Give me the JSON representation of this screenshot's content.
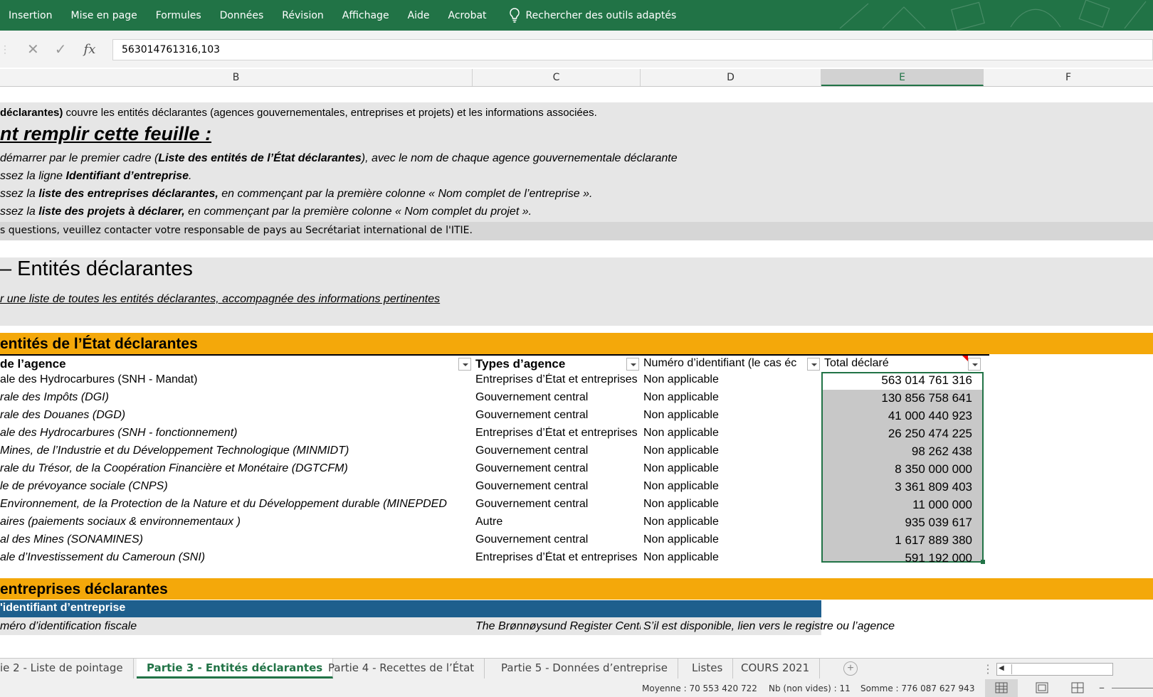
{
  "ribbon": {
    "tabs": [
      "Insertion",
      "Mise en page",
      "Formules",
      "Données",
      "Révision",
      "Affichage",
      "Aide",
      "Acrobat"
    ],
    "search_label": "Rechercher des outils adaptés"
  },
  "formula_bar": {
    "cancel_icon": "✕",
    "enter_icon": "✓",
    "fx_label": "fx",
    "value": "563014761316,103"
  },
  "columns": [
    "B",
    "C",
    "D",
    "E",
    "F"
  ],
  "selected_column": "E",
  "sheet": {
    "intro": {
      "line1_bold": "déclarantes)",
      "line1_rest": " couvre les entités déclarantes (agences gouvernementales, entreprises et projets) et les informations associées.",
      "how_to_title": "nt remplir cette feuille :",
      "step1_pre": "démarrer par le premier cadre (",
      "step1_bold": "Liste des entités de l’État déclarantes",
      "step1_post": "), avec le nom de chaque agence gouvernementale déclarante",
      "step2_pre": "ssez la ligne ",
      "step2_bold": "Identifiant d’entreprise",
      "step2_post": ".",
      "step3_pre": "ssez la ",
      "step3_bold": "liste des entreprises déclarantes,",
      "step3_post": " en commençant par la première colonne « Nom complet de l’entreprise ».",
      "step4_pre": "ssez la ",
      "step4_bold": "liste des projets à déclarer,",
      "step4_post": " en commençant par la première colonne « Nom complet du projet ».",
      "contact": "s questions, veuillez contacter votre responsable de pays au Secrétariat international de l'ITIE."
    },
    "section_title": "– Entités déclarantes",
    "section_subtitle": "r une liste de toutes les entités déclarantes, accompagnée des informations pertinentes",
    "state_table": {
      "title": "entités de l’État déclarantes",
      "headers": [
        "de l’agence",
        "Types d’agence",
        "Numéro d’identifiant (le cas éc",
        "Total déclaré"
      ],
      "rows": [
        {
          "name": "ale des Hydrocarbures (SNH - Mandat)",
          "type": "Entreprises d’État et entreprises",
          "id": "Non applicable",
          "total": "563 014 761 316",
          "italic": false
        },
        {
          "name": "rale des Impôts (DGI)",
          "type": "Gouvernement central",
          "id": "Non applicable",
          "total": "130 856 758 641",
          "italic": true
        },
        {
          "name": "rale des Douanes (DGD)",
          "type": "Gouvernement central",
          "id": "Non applicable",
          "total": "41 000 440 923",
          "italic": true
        },
        {
          "name": "ale des Hydrocarbures (SNH - fonctionnement)",
          "type": "Entreprises d’État et entreprises",
          "id": "Non applicable",
          "total": "26 250 474 225",
          "italic": true
        },
        {
          "name": "Mines, de l’Industrie et du Développement Technologique (MINMIDT)",
          "type": "Gouvernement central",
          "id": "Non applicable",
          "total": "98 262 438",
          "italic": true
        },
        {
          "name": "rale du Trésor, de la Coopération Financière et Monétaire (DGTCFM)",
          "type": "Gouvernement central",
          "id": "Non applicable",
          "total": "8 350 000 000",
          "italic": true
        },
        {
          "name": "le de prévoyance sociale (CNPS)",
          "type": "Gouvernement central",
          "id": "Non applicable",
          "total": "3 361 809 403",
          "italic": true
        },
        {
          "name": "Environnement, de la Protection de la Nature et du Développement durable (MINEPDED",
          "type": "Gouvernement central",
          "id": "Non applicable",
          "total": "11 000 000",
          "italic": true
        },
        {
          "name": "aires (paiements sociaux & environnementaux )",
          "type": "Autre",
          "id": "Non applicable",
          "total": "935 039 617",
          "italic": true
        },
        {
          "name": "al des Mines (SONAMINES)",
          "type": "Gouvernement central",
          "id": "Non applicable",
          "total": "1 617 889 380",
          "italic": true
        },
        {
          "name": "ale d’Investissement du Cameroun (SNI)",
          "type": "Entreprises d’État et entreprises",
          "id": "Non applicable",
          "total": "591 192 000",
          "italic": true
        }
      ]
    },
    "companies": {
      "title": "entreprises déclarantes",
      "id_header": "'identifiant d’entreprise",
      "row_a": "méro d’identification fiscale",
      "row_b": "The Brønnøysund Register Centre",
      "row_c": "S’il est disponible, lien vers le registre ou l’agence"
    }
  },
  "sheet_tabs": [
    "ie 2 - Liste de pointage",
    "Partie 3 - Entités déclarantes",
    "Partie 4 - Recettes de l’État",
    "Partie 5 - Données d’entreprise",
    "Listes",
    "COURS 2021"
  ],
  "active_sheet_tab": "Partie 3 - Entités déclarantes",
  "status": {
    "average": "Moyenne :  70 553 420 722",
    "count": "Nb (non vides) : 11",
    "sum": "Somme :  776 087 627 943"
  }
}
